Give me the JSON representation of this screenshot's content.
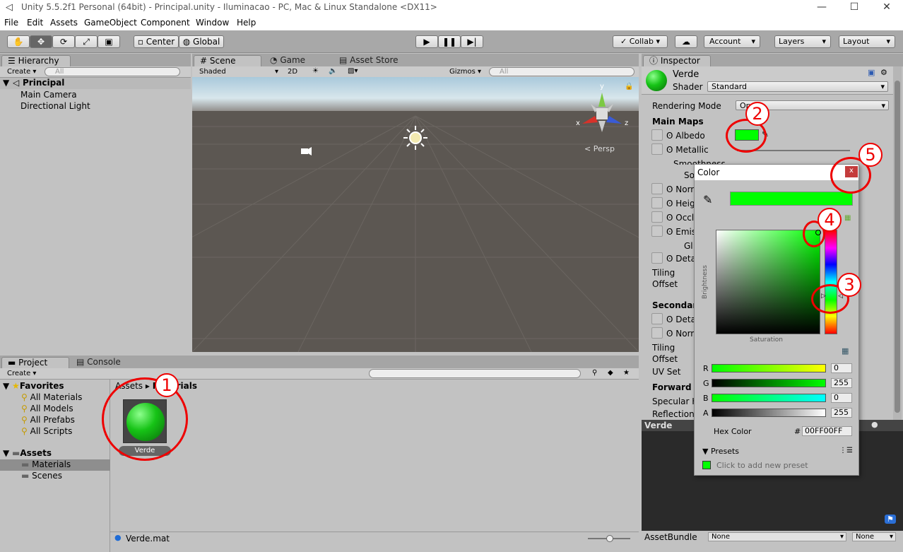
{
  "window": {
    "title": "Unity 5.5.2f1 Personal (64bit) - Principal.unity - Iluminacao - PC, Mac & Linux Standalone <DX11>"
  },
  "menu": [
    "File",
    "Edit",
    "Assets",
    "GameObject",
    "Component",
    "Window",
    "Help"
  ],
  "toolbar": {
    "center": "Center",
    "global": "Global",
    "collab": "Collab",
    "account": "Account",
    "layers": "Layers",
    "layout": "Layout"
  },
  "hierarchy": {
    "tab": "Hierarchy",
    "create": "Create",
    "search": "All",
    "scene": "Principal",
    "items": [
      "Main Camera",
      "Directional Light"
    ]
  },
  "sceneview": {
    "tabs": [
      "Scene",
      "Game",
      "Asset Store"
    ],
    "shading": "Shaded",
    "mode2d": "2D",
    "gizmos": "Gizmos",
    "search": "All",
    "persp": "Persp",
    "axes": {
      "x": "x",
      "y": "y",
      "z": "z"
    }
  },
  "project": {
    "tabs": [
      "Project",
      "Console"
    ],
    "create": "Create",
    "favorites": "Favorites",
    "fav_items": [
      "All Materials",
      "All Models",
      "All Prefabs",
      "All Scripts"
    ],
    "assets": "Assets",
    "folders": [
      "Materials",
      "Scenes"
    ],
    "breadcrumb": [
      "Assets",
      "Materials"
    ],
    "asset_name": "Verde",
    "footer": "Verde.mat"
  },
  "inspector": {
    "tab": "Inspector",
    "name": "Verde",
    "shader_label": "Shader",
    "shader_value": "Standard",
    "rendering_mode_label": "Rendering Mode",
    "rendering_mode_value": "Op",
    "main_maps": "Main Maps",
    "albedo": "Albedo",
    "metallic": "Metallic",
    "smoothness": "Smoothness",
    "source": "So",
    "normal": "Norm",
    "height": "Heigh",
    "occlusion": "Occlu",
    "emission": "Emiss",
    "gi": "Gl",
    "detail": "Detai",
    "tiling": "Tiling",
    "offset": "Offset",
    "secondary": "Secondar",
    "detail2": "Detai",
    "normal2": "Norm",
    "tiling2": "Tiling",
    "offset2": "Offset",
    "uvset": "UV Set",
    "forward": "Forward R",
    "specular": "Specular H",
    "reflections": "Reflections",
    "preview_name": "Verde",
    "assetbundle": "AssetBundle",
    "ab_none": "None",
    "ab_none2": "None",
    "albedo_color": "#00ff00"
  },
  "color_picker": {
    "title": "Color",
    "close": "x",
    "brightness": "Brightness",
    "saturation": "Saturation",
    "channels": [
      {
        "label": "R",
        "value": "0"
      },
      {
        "label": "G",
        "value": "255"
      },
      {
        "label": "B",
        "value": "0"
      },
      {
        "label": "A",
        "value": "255"
      }
    ],
    "hex_label": "Hex Color",
    "hex_prefix": "#",
    "hex_value": "00FF00FF",
    "presets": "Presets",
    "add_preset": "Click to add new preset",
    "current_color": "#00ff00"
  },
  "annotations": [
    "1",
    "2",
    "3",
    "4",
    "5"
  ]
}
